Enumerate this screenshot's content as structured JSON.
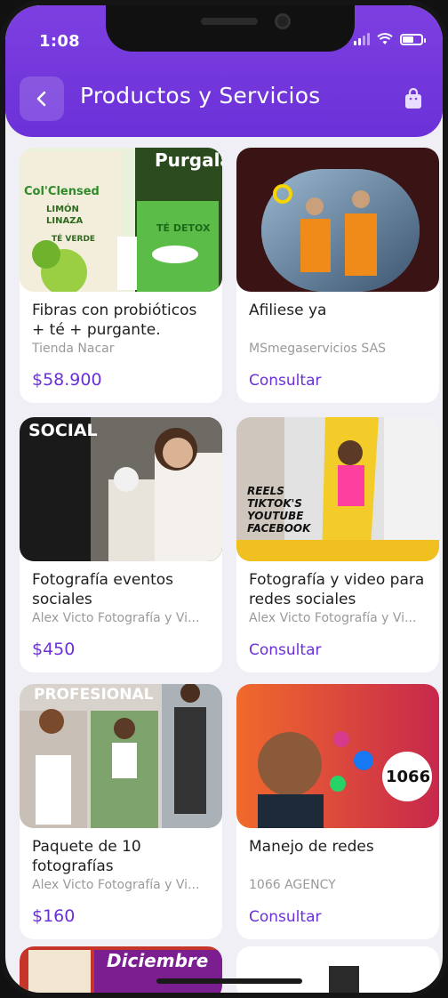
{
  "status_bar": {
    "time": "1:08"
  },
  "header": {
    "title": "Productos y Servicios"
  },
  "products": [
    {
      "title": "Fibras con probióticos + té + purgante.",
      "seller": "Tienda Nacar",
      "action": "$58.900",
      "is_price": true,
      "image_text": [
        "Col'Clensed",
        "LIMÓN",
        "LINAZA",
        "TÉ VERDE",
        "Purgala",
        "TÉ DETOX"
      ]
    },
    {
      "title": "Afiliese ya",
      "seller": "MSmegaservicios SAS",
      "action": "Consultar",
      "is_price": false
    },
    {
      "title": "Fotografía eventos sociales",
      "seller": "Alex Victo Fotografía y Vi...",
      "action": "$450",
      "is_price": true,
      "image_text": [
        "SOCIAL"
      ]
    },
    {
      "title": "Fotografía y video para redes sociales",
      "seller": "Alex Victo Fotografía y Vi...",
      "action": "Consultar",
      "is_price": false,
      "image_text": [
        "REELS",
        "TIKTOK'S",
        "YOUTUBE",
        "FACEBOOK"
      ]
    },
    {
      "title": "Paquete de 10 fotografías",
      "seller": "Alex Victo Fotografía y Vi...",
      "action": "$160",
      "is_price": true,
      "image_text": [
        "PROFESIONAL"
      ]
    },
    {
      "title": "Manejo de redes",
      "seller": "1066 AGENCY",
      "action": "Consultar",
      "is_price": false,
      "image_text": [
        "1066"
      ]
    },
    {
      "image_text": [
        "Diciembre"
      ]
    }
  ],
  "colors": {
    "accent": "#6b31d8",
    "header": "#7d3fe0",
    "background": "#f1eff6"
  }
}
